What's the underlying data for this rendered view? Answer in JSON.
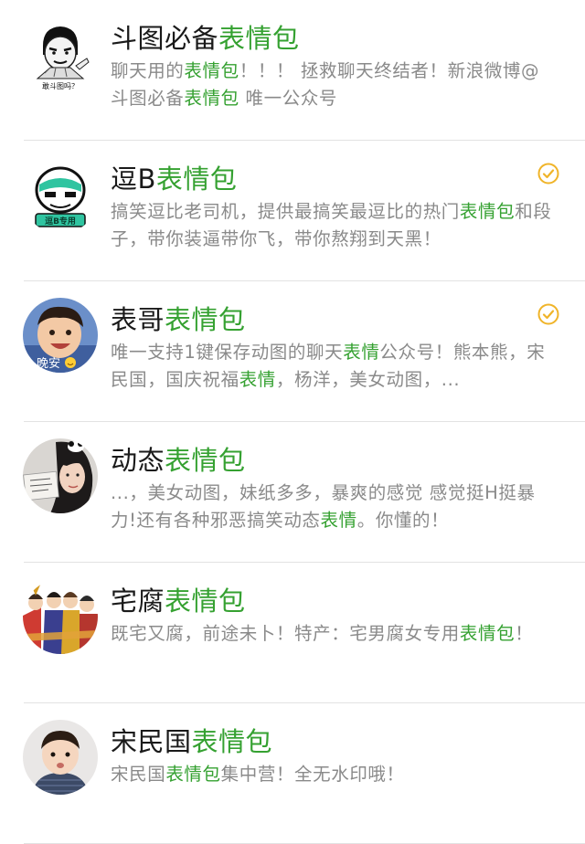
{
  "accounts": [
    {
      "name_plain": "斗图必备",
      "name_hl": "表情包",
      "verified": false,
      "avatar_icon": "meme-face-avatar-icon",
      "avatar_text": "敢斗图吗？",
      "desc": [
        {
          "t": "聊天用的",
          "h": false
        },
        {
          "t": "表情包",
          "h": true
        },
        {
          "t": "！！！ 拯救聊天终结者！新浪微博@斗图必备",
          "h": false
        },
        {
          "t": "表情包",
          "h": true
        },
        {
          "t": " 唯一公众号",
          "h": false
        }
      ]
    },
    {
      "name_plain": "逗B",
      "name_hl": "表情包",
      "verified": true,
      "avatar_icon": "green-mask-avatar-icon",
      "avatar_text": "逗B专用",
      "desc": [
        {
          "t": "搞笑逗比老司机，提供最搞笑最逗比的热门",
          "h": false
        },
        {
          "t": "表情包",
          "h": true
        },
        {
          "t": "和段子，带你装逼带你飞，带你熬翔到天黑！",
          "h": false
        }
      ]
    },
    {
      "name_plain": "表哥",
      "name_hl": "表情包",
      "verified": true,
      "avatar_icon": "child-photo-avatar-icon",
      "avatar_text": "晚安",
      "desc": [
        {
          "t": "唯一支持1键保存动图的聊天",
          "h": false
        },
        {
          "t": "表情",
          "h": true
        },
        {
          "t": "公众号！熊本熊，宋民国，国庆祝福",
          "h": false
        },
        {
          "t": "表情",
          "h": true
        },
        {
          "t": "，杨洋，美女动图，...",
          "h": false
        }
      ]
    },
    {
      "name_plain": "动态",
      "name_hl": "表情包",
      "verified": false,
      "avatar_icon": "girl-photo-avatar-icon",
      "avatar_text": "",
      "desc": [
        {
          "t": "...，美女动图，妹纸多多，暴爽的感觉 感觉挺H挺暴力!还有各种邪恶搞笑动态",
          "h": false
        },
        {
          "t": "表情",
          "h": true
        },
        {
          "t": "。你懂的！",
          "h": false
        }
      ]
    },
    {
      "name_plain": "宅腐",
      "name_hl": "表情包",
      "verified": false,
      "avatar_icon": "anime-group-avatar-icon",
      "avatar_text": "",
      "desc": [
        {
          "t": "既宅又腐，前途未卜！特产：宅男腐女专用",
          "h": false
        },
        {
          "t": "表情包",
          "h": true
        },
        {
          "t": "！",
          "h": false
        }
      ]
    },
    {
      "name_plain": "宋民国",
      "name_hl": "表情包",
      "verified": false,
      "avatar_icon": "toddler-photo-avatar-icon",
      "avatar_text": "",
      "desc": [
        {
          "t": "宋民国",
          "h": false
        },
        {
          "t": "表情包",
          "h": true
        },
        {
          "t": "集中营！全无水印哦！",
          "h": false
        }
      ]
    }
  ],
  "colors": {
    "highlight": "#35a131",
    "title": "#1a1a1a",
    "desc": "#8a8a8a",
    "divider": "#e2e2e2",
    "verified": "#f0b429"
  }
}
